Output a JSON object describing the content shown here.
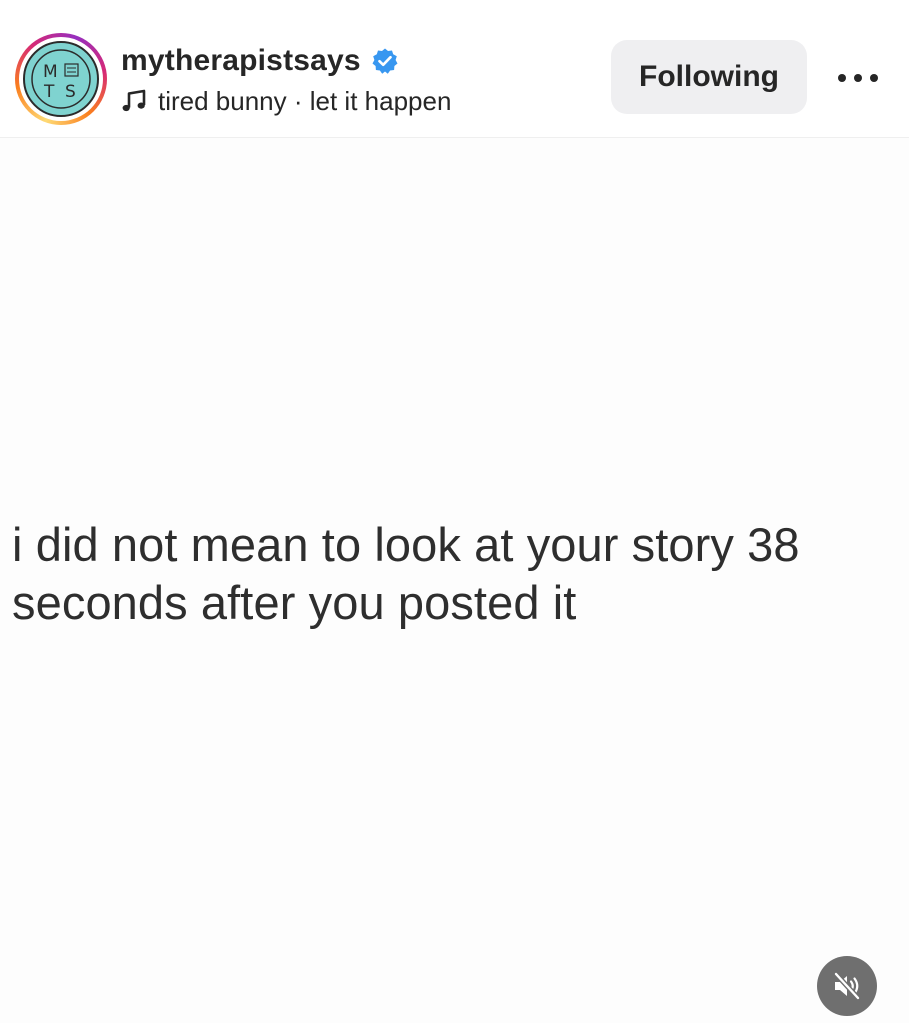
{
  "post_header": {
    "username": "mytherapistsays",
    "verified": true,
    "audio": {
      "icon": "music-note-icon",
      "text": "tired bunny · let it happen"
    },
    "follow_button_label": "Following",
    "more_icon": "more-options-icon"
  },
  "avatar": {
    "logo_letters": [
      "M",
      "T",
      "S"
    ],
    "colors": {
      "fill": "#7fd3d0",
      "ring_gradient": [
        "#feda75",
        "#fa7e1e",
        "#d62976",
        "#962fbf"
      ]
    }
  },
  "media": {
    "caption_line_1": "i did not mean to look at your story 38",
    "caption_line_2": "seconds after you posted it",
    "sound_icon": "muted-speaker-icon"
  },
  "colors": {
    "verified_badge": "#3897f0",
    "button_bg": "#efeff1",
    "text": "#262626"
  }
}
